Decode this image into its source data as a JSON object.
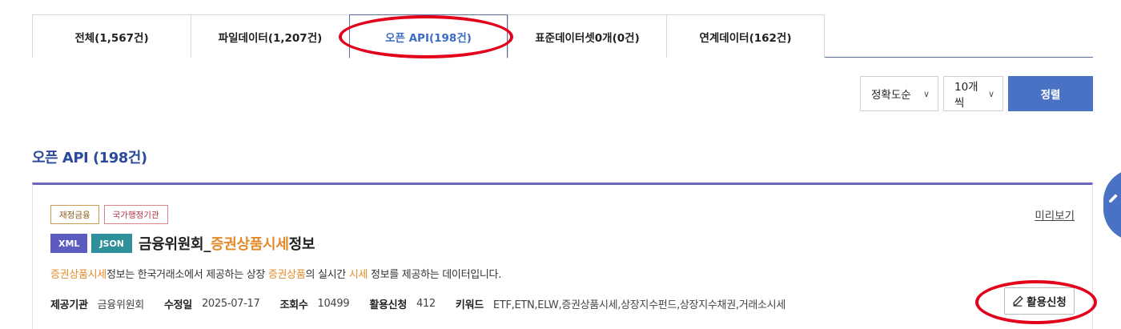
{
  "tabs": [
    {
      "label": "전체(1,567건)",
      "active": false
    },
    {
      "label": "파일데이터(1,207건)",
      "active": false
    },
    {
      "label": "오픈 API(198건)",
      "active": true
    },
    {
      "label": "표준데이터셋0개(0건)",
      "active": false
    },
    {
      "label": "연계데이터(162건)",
      "active": false
    }
  ],
  "controls": {
    "order_select": "정확도순",
    "count_select": "10개씩",
    "sort_button": "정렬"
  },
  "section_title": "오픈 API (198건)",
  "result": {
    "category_badge": "재정금융",
    "org_badge": "국가행정기관",
    "preview_link": "미리보기",
    "formats": [
      "XML",
      "JSON"
    ],
    "title_prefix": "금융위원회_",
    "title_highlight": "증권상품시세",
    "title_suffix": "정보",
    "desc_parts": [
      "증권상품시세",
      "정보는 한국거래소에서 제공하는 상장 ",
      "증권상품",
      "의 실시간 ",
      "시세",
      " 정보를 제공하는 데이터입니다."
    ],
    "meta": {
      "provider_label": "제공기관",
      "provider_value": "금융위원회",
      "modified_label": "수정일",
      "modified_value": "2025-07-17",
      "views_label": "조회수",
      "views_value": "10499",
      "apply_count_label": "활용신청",
      "apply_count_value": "412",
      "keywords_label": "키워드",
      "keywords_value": "ETF,ETN,ELW,증권상품시세,상장지수펀드,상장지수채권,거래소시세"
    },
    "apply_button": "활용신청"
  },
  "colors": {
    "accent_blue": "#4a72c4",
    "active_tab_text": "#3d6cc4",
    "highlight": "#e38b2b",
    "annotation_red": "#e3001b",
    "card_border_top": "#6b66c2"
  },
  "icons": {
    "apply_icon": "pencil-icon",
    "float_icon": "pencil-icon"
  }
}
